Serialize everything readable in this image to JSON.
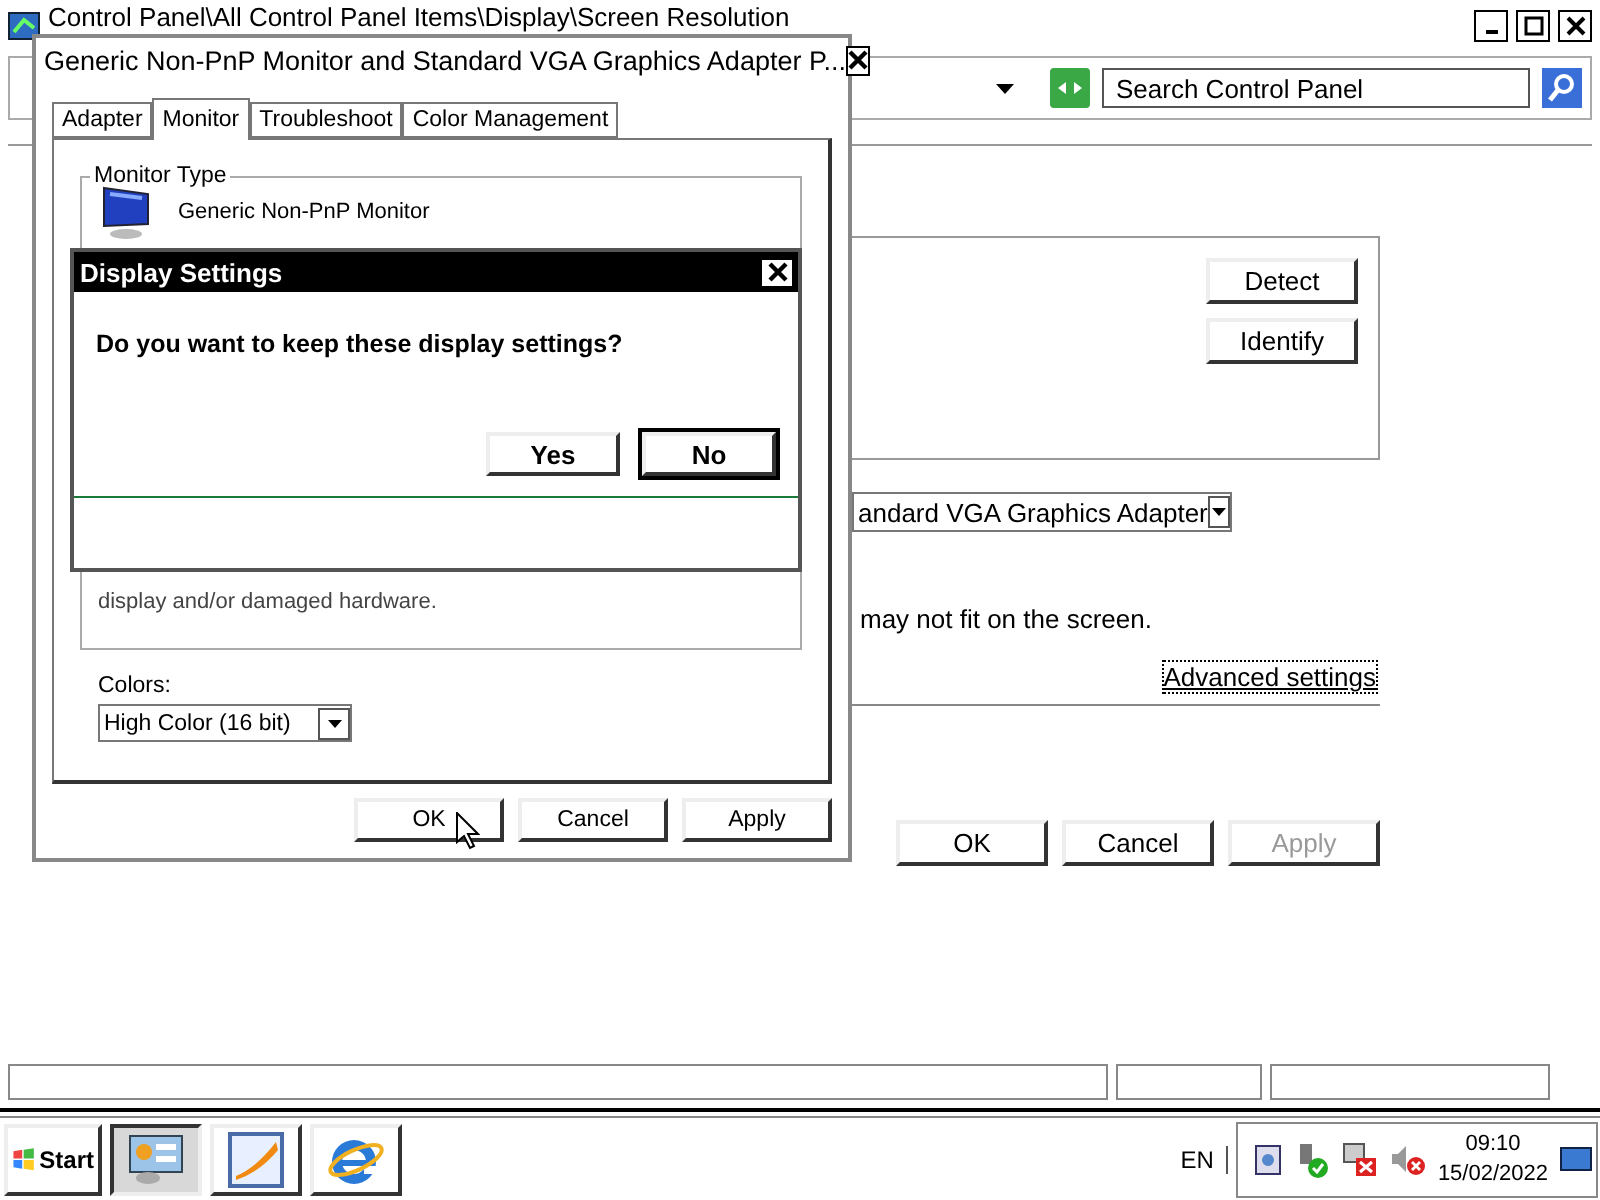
{
  "main_window": {
    "title": "Control Panel\\All Control Panel Items\\Display\\Screen Resolution",
    "search": {
      "placeholder": "Search Control Panel"
    },
    "side_buttons": [
      "Detect",
      "Identify"
    ],
    "adapter_dropdown": "andard VGA Graphics Adapter",
    "notice": "may not fit on the screen.",
    "advanced_link": "Advanced settings",
    "buttons": [
      {
        "label": "OK",
        "disabled": false
      },
      {
        "label": "Cancel",
        "disabled": false
      },
      {
        "label": "Apply",
        "disabled": true
      }
    ]
  },
  "properties_dialog": {
    "title": "Generic Non-PnP Monitor and Standard VGA Graphics Adapter P...",
    "tabs": [
      {
        "label": "Adapter",
        "selected": false
      },
      {
        "label": "Monitor",
        "selected": true
      },
      {
        "label": "Troubleshoot",
        "selected": false
      },
      {
        "label": "Color Management",
        "selected": false
      }
    ],
    "monitor_type": {
      "legend": "Monitor Type",
      "name": "Generic Non-PnP Monitor"
    },
    "warning_fragment": "display and/or damaged hardware.",
    "colors": {
      "label": "Colors:",
      "value": "High Color (16 bit)"
    },
    "buttons": [
      {
        "label": "OK",
        "disabled": false
      },
      {
        "label": "Cancel",
        "disabled": false
      },
      {
        "label": "Apply",
        "disabled": false
      }
    ]
  },
  "confirm_dialog": {
    "title": "Display Settings",
    "message": "Do you want to keep these display settings?",
    "buttons": [
      {
        "label": "Yes",
        "default": false
      },
      {
        "label": "No",
        "default": true
      }
    ]
  },
  "taskbar": {
    "start": "Start",
    "apps": [
      {
        "kind": "control-panel",
        "selected": true
      },
      {
        "kind": "paint",
        "selected": false
      },
      {
        "kind": "browser",
        "selected": false
      }
    ],
    "language": "EN",
    "time": "09:10",
    "date": "15/02/2022"
  }
}
